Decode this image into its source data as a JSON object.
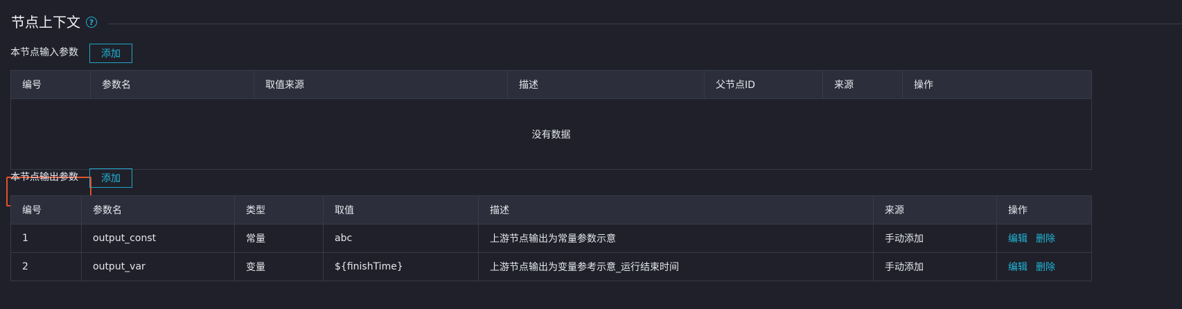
{
  "context": {
    "title": "节点上下文",
    "help_glyph": "?"
  },
  "input_params": {
    "label": "本节点输入参数",
    "add_label": "添加",
    "columns": [
      "编号",
      "参数名",
      "取值来源",
      "描述",
      "父节点ID",
      "来源",
      "操作"
    ],
    "empty_text": "没有数据"
  },
  "output_params": {
    "label": "本节点输出参数",
    "add_label": "添加",
    "columns": [
      "编号",
      "参数名",
      "类型",
      "取值",
      "描述",
      "来源",
      "操作"
    ],
    "rows": [
      {
        "id": "1",
        "name": "output_const",
        "type": "常量",
        "value": "abc",
        "desc": "上游节点输出为常量参数示意",
        "source": "手动添加",
        "edit": "编辑",
        "delete": "删除"
      },
      {
        "id": "2",
        "name": "output_var",
        "type": "变量",
        "value": "${finishTime}",
        "desc": "上游节点输出为变量参考示意_运行结束时间",
        "source": "手动添加",
        "edit": "编辑",
        "delete": "删除"
      }
    ]
  },
  "colors": {
    "background": "#1f2029",
    "header_bg": "#2c2e3b",
    "accent": "#22b4d8",
    "highlight": "#e2532d"
  }
}
